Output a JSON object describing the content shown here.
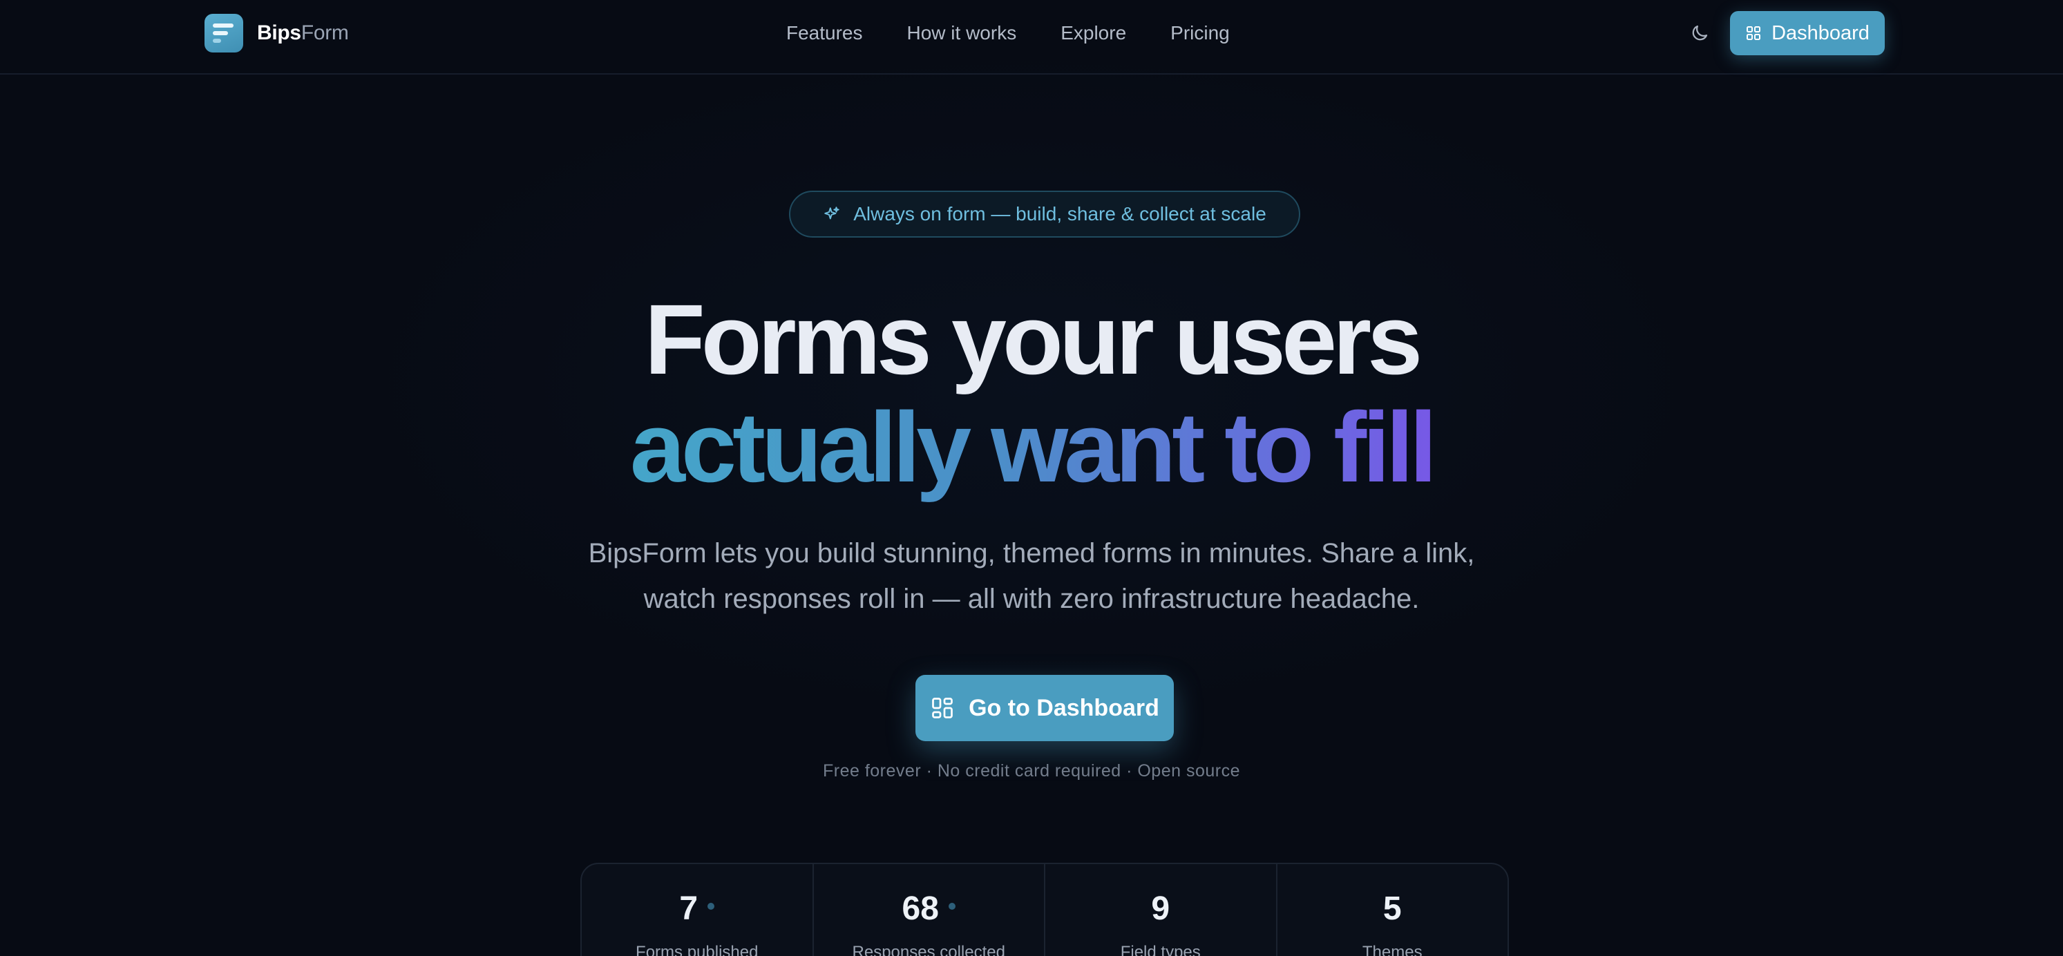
{
  "brand": {
    "name_primary": "Bips",
    "name_secondary": "Form"
  },
  "nav": {
    "links": [
      "Features",
      "How it works",
      "Explore",
      "Pricing"
    ],
    "dashboard_label": "Dashboard",
    "theme_toggle_icon": "moon-icon"
  },
  "hero": {
    "badge": "Always on form — build, share & collect at scale",
    "headline_line1": "Forms your users",
    "headline_line2": "actually want to fill",
    "subtitle_line1": "BipsForm lets you build stunning, themed forms in minutes. Share a link,",
    "subtitle_line2": "watch responses roll in — all with zero infrastructure headache.",
    "cta_label": "Go to Dashboard",
    "fineprint": "Free forever · No credit card required · Open source"
  },
  "stats": [
    {
      "value": "7",
      "label": "Forms published"
    },
    {
      "value": "68",
      "label": "Responses collected"
    },
    {
      "value": "9",
      "label": "Field types"
    },
    {
      "value": "5",
      "label": "Themes"
    }
  ],
  "colors": {
    "background": "#070b14",
    "accent": "#4a9dc0",
    "gradient_start": "#45a6c9",
    "gradient_end": "#7758e6"
  }
}
